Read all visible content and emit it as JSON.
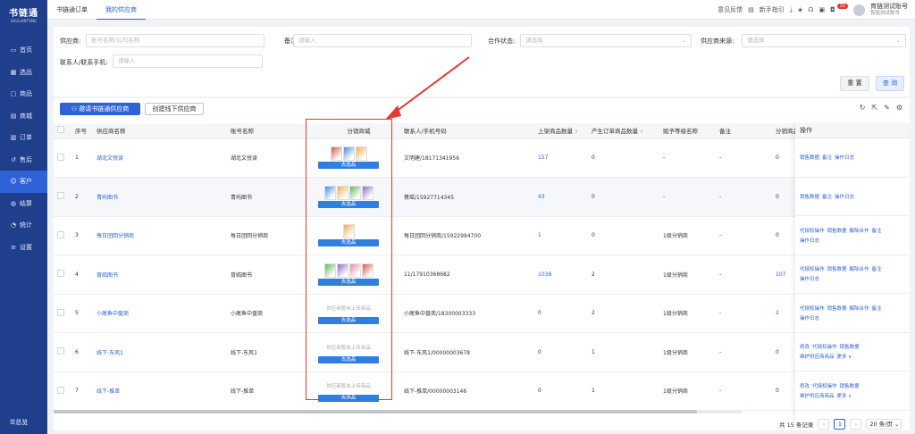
{
  "app": {
    "logo": "书链通",
    "logo_sub": "SHULIANTONG"
  },
  "sidebar": {
    "items": [
      {
        "label": "首页",
        "icon": "home-icon"
      },
      {
        "label": "选品",
        "icon": "select-icon"
      },
      {
        "label": "商品",
        "icon": "goods-icon"
      },
      {
        "label": "商城",
        "icon": "shop-icon"
      },
      {
        "label": "订单",
        "icon": "order-icon"
      },
      {
        "label": "售后",
        "icon": "aftersale-icon"
      },
      {
        "label": "客户",
        "icon": "customer-icon"
      },
      {
        "label": "结算",
        "icon": "settle-icon"
      },
      {
        "label": "统计",
        "icon": "stats-icon"
      },
      {
        "label": "设置",
        "icon": "settings-icon"
      }
    ],
    "bottom": "总览"
  },
  "topbar": {
    "tabs": [
      "书链通订单",
      "我的供应商"
    ],
    "feedback": "意见反馈",
    "guide": "新手指引",
    "badge": "31",
    "user_name": "育链测试账号",
    "user_sub": "育链测试账号"
  },
  "filter": {
    "supplier_label": "供应商:",
    "supplier_placeholder": "账号名称/公司名称",
    "remark_label": "备注:",
    "remark_placeholder": "请输入",
    "coop_label": "合作状态:",
    "coop_placeholder": "请选择",
    "source_label": "供应商来源:",
    "source_placeholder": "请选择",
    "contact_label": "联系人/联系手机:",
    "contact_placeholder": "请输入",
    "reset": "重 置",
    "query": "查 询"
  },
  "list": {
    "invite": "邀请书链通供应商",
    "create": "创建线下供应商",
    "headers": [
      "序号",
      "供应商名称",
      "账号名称",
      "分销商城",
      "联系人/手机号码",
      "上架商品数量",
      "产生订单商品数量",
      "赋予等级名称",
      "备注",
      "分销商品"
    ],
    "ops_header": "操作",
    "go_select": "去选品",
    "no_product": "供应商暂未上传商品",
    "rows": [
      {
        "no": "1",
        "name": "湖北文悦读",
        "account": "湖北文悦读",
        "thumbs": 3,
        "contact": "文明建/18171341956",
        "listed": "157",
        "listed_link": true,
        "ordered": "0",
        "level": "-",
        "remark": "-",
        "dist": "0",
        "dist_link": false,
        "ops": [
          [
            "销售数据",
            "备注",
            "操作日志"
          ]
        ]
      },
      {
        "no": "2",
        "name": "青屿图书",
        "account": "青屿图书",
        "thumbs": 4,
        "contact": "蔡瑶/15927714345",
        "listed": "43",
        "listed_link": true,
        "ordered": "0",
        "level": "-",
        "remark": "-",
        "dist": "0",
        "dist_link": false,
        "ops": [
          [
            "销售数据",
            "备注",
            "操作日志"
          ]
        ]
      },
      {
        "no": "3",
        "name": "每日团回分销商",
        "account": "每日团回分销商",
        "thumbs": 1,
        "contact": "每日团回分销商/15922994700",
        "listed": "1",
        "listed_link": true,
        "ordered": "0",
        "level": "1级分销商",
        "remark": "-",
        "dist": "0",
        "dist_link": false,
        "ops": [
          [
            "代授权操作",
            "销售数据",
            "解除合作",
            "备注"
          ],
          [
            "操作日志"
          ]
        ]
      },
      {
        "no": "4",
        "name": "育临图书",
        "account": "育临图书",
        "thumbs": 4,
        "contact": "11/17910368682",
        "listed": "1038",
        "listed_link": true,
        "ordered": "2",
        "level": "1级分销商",
        "remark": "-",
        "dist": "107",
        "dist_link": true,
        "ops": [
          [
            "代授权操作",
            "销售数据",
            "解除合作",
            "备注"
          ],
          [
            "操作日志"
          ]
        ]
      },
      {
        "no": "5",
        "name": "小尾鱼中盘商",
        "account": "小尾鱼中盘商",
        "thumbs": 0,
        "contact": "小尾鱼中盘商/18300003333",
        "listed": "0",
        "listed_link": false,
        "ordered": "2",
        "level": "1级分销商",
        "remark": "-",
        "dist": "2",
        "dist_link": true,
        "ops": [
          [
            "代授权操作",
            "销售数据",
            "解除合作",
            "备注"
          ],
          [
            "操作日志"
          ]
        ]
      },
      {
        "no": "6",
        "name": "线下-东风1",
        "account": "线下-东风1",
        "thumbs": 0,
        "contact": "线下-东风1/00000003678",
        "listed": "0",
        "listed_link": false,
        "ordered": "1",
        "level": "1级分销商",
        "remark": "-",
        "dist": "0",
        "dist_link": false,
        "ops": [
          [
            "修改",
            "代授权操作",
            "销售数据"
          ],
          [
            "维护供应商商品",
            "更多 ∨"
          ]
        ]
      },
      {
        "no": "7",
        "name": "线下-推单",
        "account": "线下-推单",
        "thumbs": 0,
        "contact": "线下-推单/00000003146",
        "listed": "0",
        "listed_link": false,
        "ordered": "1",
        "level": "1级分销商",
        "remark": "-",
        "dist": "0",
        "dist_link": false,
        "ops": [
          [
            "修改",
            "代授权操作",
            "销售数据"
          ],
          [
            "维护供应商商品",
            "更多 ∨"
          ]
        ]
      }
    ]
  },
  "pager": {
    "total": "共 15 条记录",
    "page": "1",
    "size": "20 条/页"
  },
  "colors": {
    "primary": "#2e62d6",
    "sidebar": "#1f3e8c",
    "highlight": "#e53935"
  }
}
